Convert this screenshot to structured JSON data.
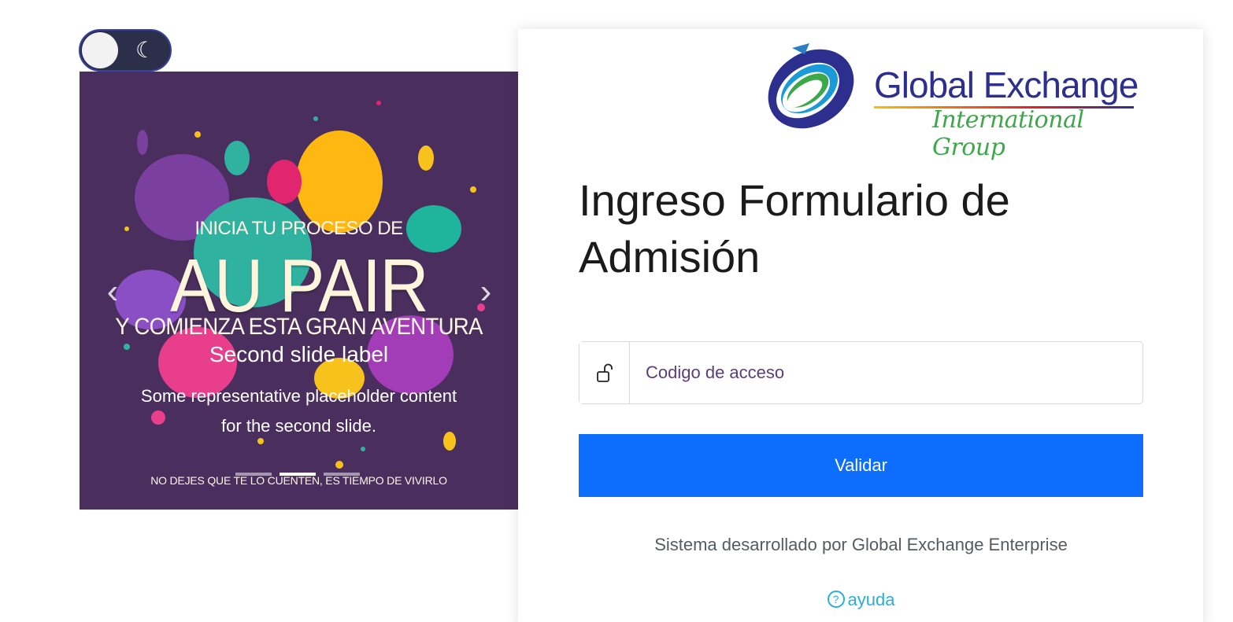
{
  "theme_toggle": {
    "icon": "moon-icon",
    "glyph": "☾"
  },
  "carousel": {
    "slide_kicker": "INICIA TU PROCESO DE",
    "slide_headline": "AU PAIR",
    "slide_subline": "Y COMIENZA ESTA GRAN AVENTURA",
    "caption_title": "Second slide label",
    "caption_body": "Some representative placeholder content for the second slide.",
    "slide_footer": "NO DEJES QUE TE LO CUENTEN, ES TIEMPO DE VIVIRLO",
    "prev_glyph": "‹",
    "next_glyph": "›",
    "indicator_count": 3,
    "active_indicator": 2
  },
  "logo": {
    "main_text": "Global Exchange",
    "sub_text": "International Group"
  },
  "login": {
    "title": "Ingreso Formulario de Admisión",
    "access_input_placeholder": "Codigo de acceso",
    "access_input_value": "",
    "lock_icon": "unlock-icon",
    "submit_label": "Validar",
    "credits": "Sistema desarrollado por Global Exchange Enterprise",
    "help_label": "ayuda",
    "help_glyph": "?"
  },
  "colors": {
    "primary_button": "#0d6efd",
    "help_link": "#2ab0d8",
    "carousel_bg": "#4a2e5e"
  }
}
